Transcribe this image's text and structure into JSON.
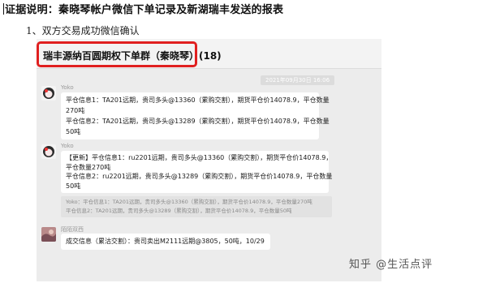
{
  "doc": {
    "title": "证据说明：秦晓琴帐户微信下单记录及新湖瑞丰发送的报表",
    "section": "1、双方交易成功微信确认"
  },
  "chat": {
    "title": "瑞丰源纳百圆期权下单群（秦晓琴）(18)",
    "timestamp": "2021年09月30日 16:06",
    "messages": [
      {
        "sender": "Yoko",
        "lines": [
          "平仓信息1：TA201远期，贵司多头@13360（累购交割），期货平仓价14078.9，平仓数量",
          "270吨",
          "平仓信息2：TA201远期，贵司多头@13289（累购交割），期货平仓价14078.9，平仓数量",
          "50吨"
        ]
      },
      {
        "sender": "Yoko",
        "lines": [
          "【更新】平仓信息1：ru2201远期，贵司多头@13360（累购交割），期货平仓价14078.9，",
          "平仓数量270吨",
          "平仓信息2：ru2201远期，贵司多头@13289（累购交割），期货平仓价14078.9，平仓数量",
          "50吨"
        ],
        "quote": [
          "Yoko：平仓信息1：TA201远期，贵司多头@13360（累购交割），期货平仓价14078.9，平仓数量270吨",
          "平仓信息2：TA201远期，贵司多头@13289（累购交割），期货平仓价14078.9，平仓数量50吨"
        ]
      },
      {
        "sender": "陌陌双西",
        "lines": [
          "成交信息（累沽交割）：贵司卖出M2111远期@3805，50吨，10/29"
        ]
      }
    ]
  },
  "watermark": {
    "text": "知乎 @生活点评"
  },
  "colors": {
    "highlight_border": "#e02020",
    "chat_background": "#ececec",
    "bubble": "#ffffff"
  }
}
